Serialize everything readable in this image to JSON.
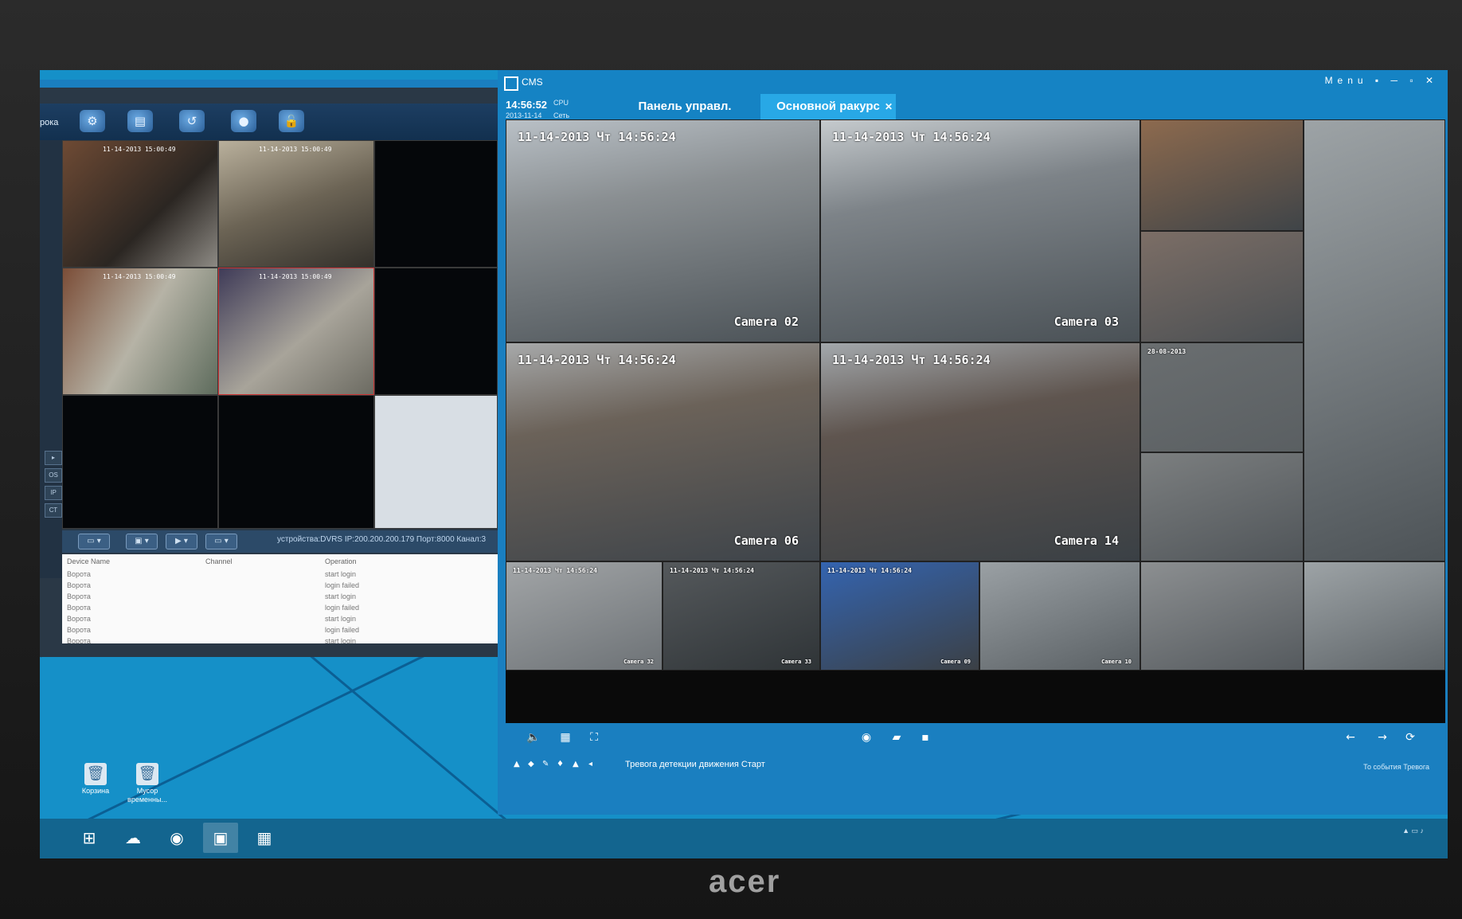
{
  "monitor": {
    "brand": "acer"
  },
  "nvr_window": {
    "title_fragment": "рока",
    "cell_timestamp": "11-14-2013 15:00:49",
    "status_text": "устройства:DVRS  IP:200.200.200.179  Порт:8000  Канал:3",
    "log": {
      "headers": {
        "device": "Device Name",
        "channel": "Channel",
        "operation": "Operation"
      },
      "rows": [
        {
          "device": "Ворота",
          "operation": "start login"
        },
        {
          "device": "Ворота",
          "operation": "login failed"
        },
        {
          "device": "Ворота",
          "operation": "start login"
        },
        {
          "device": "Ворота",
          "operation": "login failed"
        },
        {
          "device": "Ворота",
          "operation": "start login"
        },
        {
          "device": "Ворота",
          "operation": "login failed"
        },
        {
          "device": "Ворота",
          "operation": "start login"
        }
      ]
    }
  },
  "desktop": {
    "icons": [
      {
        "label": "Корзина"
      },
      {
        "label": "Мусор временны..."
      }
    ]
  },
  "cms": {
    "app_name": "CMS",
    "time": "14:56:52",
    "date": "2013-11-14",
    "cpu_label": "CPU",
    "net_label": "Сеть",
    "tabs": [
      {
        "label": "Панель управл."
      },
      {
        "label": "Основной ракурс"
      }
    ],
    "menu": "Menu",
    "large_feeds": [
      {
        "timestamp": "11-14-2013 Чт 14:56:24",
        "camera": "Camera 02",
        "colors": [
          "#8a8f92",
          "#4c5358",
          "#b9c0c6"
        ]
      },
      {
        "timestamp": "11-14-2013 Чт 14:56:24",
        "camera": "Camera 03",
        "colors": [
          "#7d8388",
          "#4a5156",
          "#c5cacd"
        ]
      },
      {
        "timestamp": "11-14-2013 Чт 14:56:24",
        "camera": "Camera 06",
        "colors": [
          "#6b6259",
          "#3e444a",
          "#a7a9aa"
        ]
      },
      {
        "timestamp": "11-14-2013 Чт 14:56:24",
        "camera": "Camera 14",
        "colors": [
          "#5f554f",
          "#3a4045",
          "#a3a8ac"
        ]
      }
    ],
    "small_feeds": [
      {
        "colors": [
          "#8d6a4e",
          "#3f4448"
        ]
      },
      {
        "colors": [
          "#7c6e66",
          "#4a4f53"
        ]
      },
      {
        "timestamp": "28-08-2013",
        "colors": [
          "#6a6e70",
          "#5a5f62"
        ]
      },
      {
        "colors": [
          "#7c7f80",
          "#505559"
        ]
      },
      {
        "timestamp": "11-14-2013 Чт 14:56:24",
        "camera": "Camera 32",
        "colors": [
          "#a2a5a7",
          "#6d7276"
        ]
      },
      {
        "timestamp": "11-14-2013 Чт 14:56:24",
        "camera": "Camera 33",
        "colors": [
          "#55595c",
          "#2f3437"
        ]
      },
      {
        "timestamp": "11-14-2013 Чт 14:56:24",
        "camera": "Camera 09",
        "colors": [
          "#3464b0",
          "#3b4045"
        ]
      },
      {
        "camera": "Camera 10",
        "colors": [
          "#9aa0a4",
          "#5a6064"
        ]
      },
      {
        "colors": [
          "#8c8f91",
          "#555a5e"
        ]
      },
      {
        "colors": [
          "#9da3a6",
          "#5e6468"
        ]
      }
    ],
    "status_message": "Тревога детекции движения Старт",
    "status_right": "То события  Тревога"
  }
}
